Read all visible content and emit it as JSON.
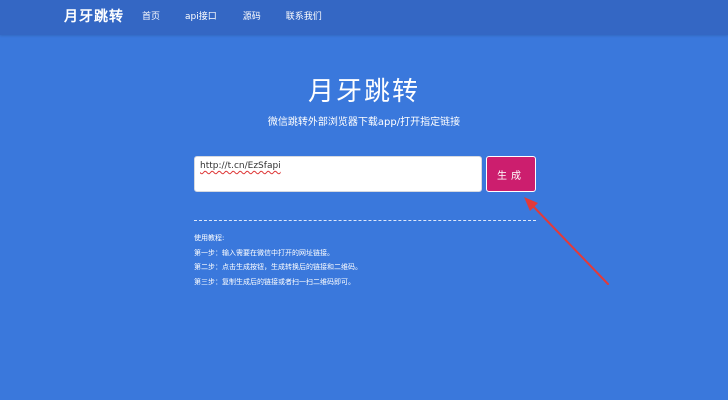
{
  "navbar": {
    "brand": "月牙跳转",
    "links": [
      "首页",
      "api接口",
      "源码",
      "联系我们"
    ]
  },
  "hero": {
    "title": "月牙跳转",
    "subtitle": "微信跳转外部浏览器下载app/打开指定链接"
  },
  "form": {
    "input_value": "http://t.cn/EzSfapi",
    "button_label": "生成"
  },
  "instructions": {
    "heading": "使用教程:",
    "steps": [
      "第一步：输入需要在微信中打开的网址链接。",
      "第二步：点击生成按钮，生成转换后的链接和二维码。",
      "第三步：复制生成后的链接或者扫一扫二维码即可。"
    ]
  },
  "colors": {
    "background": "#3a78dc",
    "navbar": "#3467c4",
    "button": "#cc1e6e",
    "annotation_arrow": "#e23a3a"
  }
}
